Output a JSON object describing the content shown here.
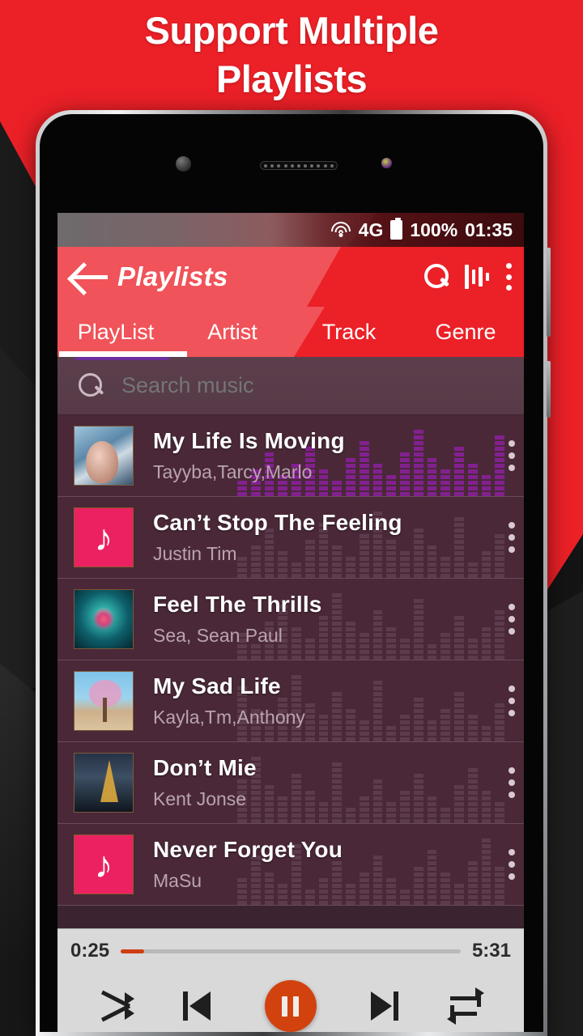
{
  "banner": {
    "line1": "Support Multiple",
    "line2": "Playlists"
  },
  "statusbar": {
    "network": "4G",
    "battery": "100%",
    "clock": "01:35"
  },
  "toolbar": {
    "title": "Playlists"
  },
  "tabs": [
    {
      "label": "PlayList",
      "active": true
    },
    {
      "label": "Artist",
      "active": false
    },
    {
      "label": "Track",
      "active": false
    },
    {
      "label": "Genre",
      "active": false
    }
  ],
  "search": {
    "placeholder": "Search music",
    "value": ""
  },
  "songs": [
    {
      "title": "My Life Is Moving",
      "artist": "Tayyba,Tarcy,Marlo",
      "art": "photo-portrait"
    },
    {
      "title": "Can’t Stop The Feeling",
      "artist": "Justin Tim",
      "art": "music-note"
    },
    {
      "title": "Feel The Thrills",
      "artist": "Sea, Sean Paul",
      "art": "photo-abstract"
    },
    {
      "title": "My Sad Life",
      "artist": "Kayla,Tm,Anthony",
      "art": "photo-tree"
    },
    {
      "title": "Don’t Mie",
      "artist": "Kent Jonse",
      "art": "photo-tower"
    },
    {
      "title": "Never Forget You",
      "artist": "MaSu",
      "art": "music-note"
    }
  ],
  "player": {
    "elapsed": "0:25",
    "total": "5:31",
    "progress_percent": 7,
    "state": "playing"
  },
  "colors": {
    "brand_red": "#ec2027",
    "accent_pink": "#ec2161",
    "player_orange": "#d2420f",
    "list_bg": "#4a2838",
    "eq_purple": "#8d1fa0"
  }
}
